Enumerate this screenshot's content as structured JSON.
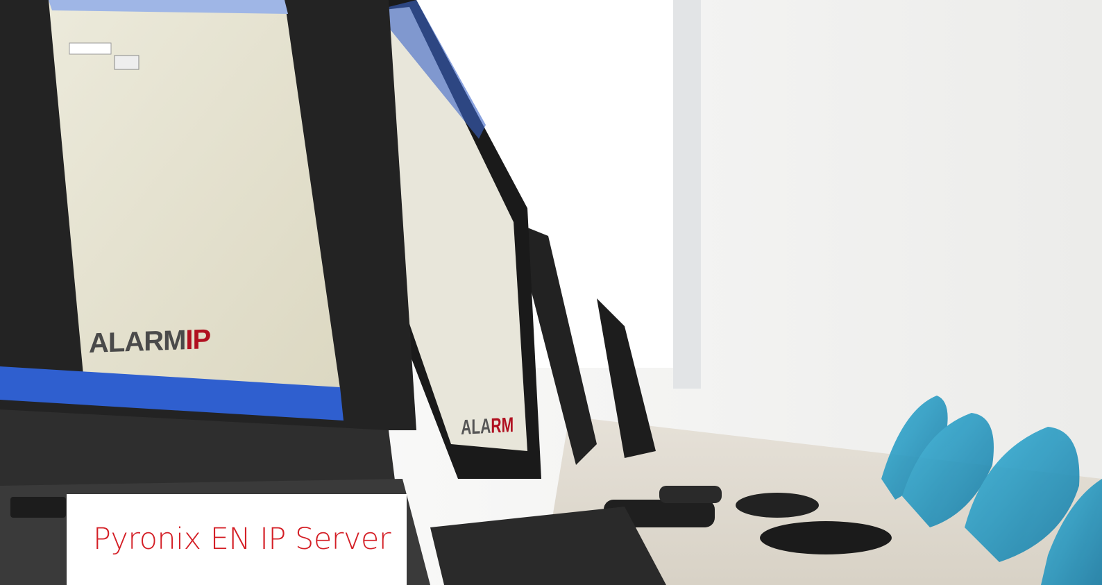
{
  "hero": {
    "caption": "Pyronix EN IP Server",
    "logo_text": "ALARM",
    "logo_accent": "IP",
    "logo_small_text": "ALA",
    "logo_small_accent": "RM"
  },
  "colors": {
    "caption_red": "#d41f26",
    "chair_blue": "#2a9ec8",
    "monitor_dark": "#1f1f1f",
    "screen_bg": "#e7e3cf",
    "taskbar_blue": "#2f5fcf"
  }
}
